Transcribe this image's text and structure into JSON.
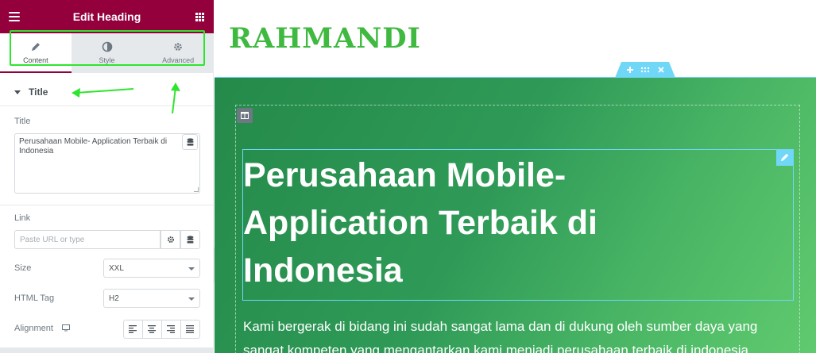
{
  "panel": {
    "title": "Edit Heading",
    "tabs": [
      {
        "label": "Content",
        "icon": "pencil-icon",
        "active": true
      },
      {
        "label": "Style",
        "icon": "contrast-icon",
        "active": false
      },
      {
        "label": "Advanced",
        "icon": "gear-icon",
        "active": false
      }
    ],
    "section_title": "Title",
    "title_field": {
      "label": "Title",
      "value": "Perusahaan Mobile- Application Terbaik di Indonesia"
    },
    "link_field": {
      "label": "Link",
      "placeholder": "Paste URL or type"
    },
    "size_field": {
      "label": "Size",
      "value": "XXL"
    },
    "html_tag_field": {
      "label": "HTML Tag",
      "value": "H2"
    },
    "alignment_field": {
      "label": "Alignment",
      "options": [
        "left",
        "center",
        "right",
        "justify"
      ]
    },
    "colors": {
      "header": "#93003c",
      "annotation": "#2ee52e"
    }
  },
  "preview": {
    "logo": "RAHMANDI",
    "heading": "Perusahaan Mobile- Application Terbaik di Indonesia",
    "paragraph": "Kami bergerak di bidang ini sudah sangat lama dan di dukung oleh sumber daya yang sangat kompeten yang mengantarkan kami menjadi perusahaan terbaik di indonesia.",
    "colors": {
      "logo": "#3fb93f",
      "section_start": "#248a4a",
      "section_end": "#5fca6e",
      "editor_accent": "#71d7f7"
    }
  }
}
